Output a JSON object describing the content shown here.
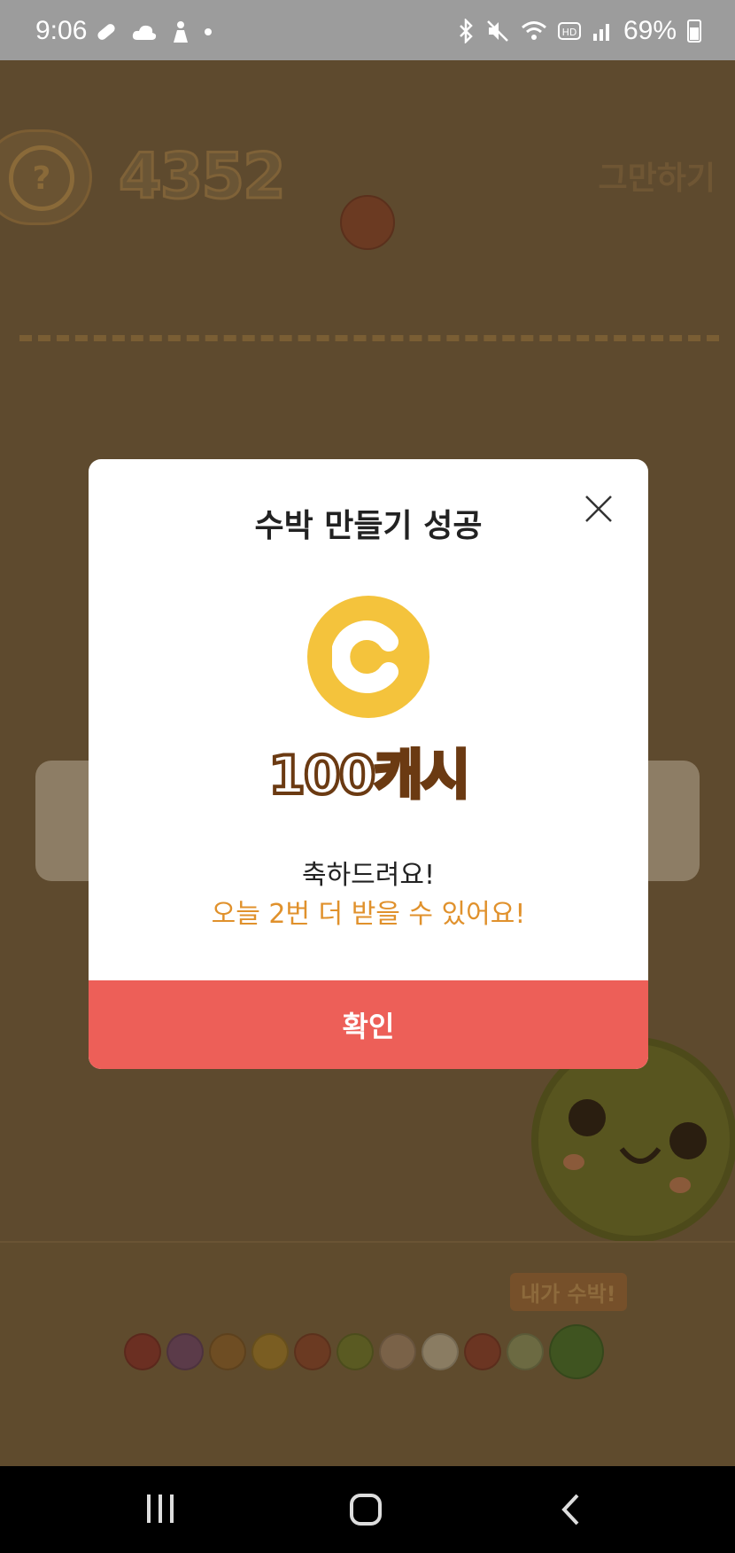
{
  "status_bar": {
    "time": "9:06",
    "battery_text": "69%",
    "left_icons": [
      "pill-icon",
      "cloud-icon",
      "person-icon",
      "dot-icon"
    ],
    "right_icons": [
      "bluetooth-icon",
      "mute-icon",
      "wifi-icon",
      "hd-icon",
      "signal-icon",
      "battery-icon"
    ]
  },
  "game": {
    "help_label": "?",
    "score": "4352",
    "quit_label": "그만하기",
    "goal_badge": "내가 수박!",
    "fruit_colors": [
      "#6b2f22",
      "#5b3b49",
      "#6e4d23",
      "#7a5d22",
      "#6b3a22",
      "#5a5a22",
      "#7a6248",
      "#8a7c62",
      "#6b3522",
      "#6c6a42",
      "#3f5420"
    ]
  },
  "dialog": {
    "title": "수박 만들기 성공",
    "reward": "100캐시",
    "congrats": "축하드려요!",
    "remaining": "오늘 2번 더 받을 수 있어요!",
    "confirm_label": "확인",
    "accent_color": "#ed5f58",
    "coin_color": "#f4c33c"
  },
  "nav": {
    "buttons": [
      "recent-apps-icon",
      "home-icon",
      "back-icon"
    ]
  }
}
